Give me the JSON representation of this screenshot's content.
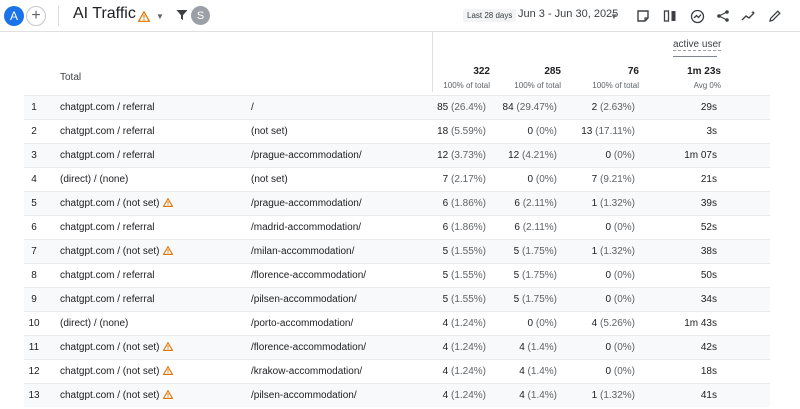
{
  "header": {
    "avatar_letter": "A",
    "add_symbol": "+",
    "title": "AI Traffic",
    "user_chip": "S",
    "date_label": "Last 28 days",
    "date_range": "Jun 3 - Jun 30, 2025",
    "icons": [
      "warning-icon",
      "chevron-down-icon",
      "filter-icon",
      "comment-icon",
      "compare-icon",
      "insights-icon",
      "share-icon",
      "trend-icon",
      "edit-icon"
    ]
  },
  "table": {
    "total_label": "Total",
    "col_hint": "active user",
    "totals": [
      {
        "value": "322",
        "sub": "100% of total"
      },
      {
        "value": "285",
        "sub": "100% of total"
      },
      {
        "value": "76",
        "sub": "100% of total"
      },
      {
        "value": "1m 23s",
        "sub": "Avg 0%"
      }
    ],
    "rows": [
      {
        "index": "1",
        "source": "chatgpt.com / referral",
        "warn": false,
        "page": "/",
        "c1": "85",
        "c1p": "(26.4%)",
        "c2": "84",
        "c2p": "(29.47%)",
        "c3": "2",
        "c3p": "(2.63%)",
        "c4": "29s"
      },
      {
        "index": "2",
        "source": "chatgpt.com / referral",
        "warn": false,
        "page": "(not set)",
        "c1": "18",
        "c1p": "(5.59%)",
        "c2": "0",
        "c2p": "(0%)",
        "c3": "13",
        "c3p": "(17.11%)",
        "c4": "3s"
      },
      {
        "index": "3",
        "source": "chatgpt.com / referral",
        "warn": false,
        "page": "/prague-accommodation/",
        "c1": "12",
        "c1p": "(3.73%)",
        "c2": "12",
        "c2p": "(4.21%)",
        "c3": "0",
        "c3p": "(0%)",
        "c4": "1m 07s"
      },
      {
        "index": "4",
        "source": "(direct) / (none)",
        "warn": false,
        "page": "(not set)",
        "c1": "7",
        "c1p": "(2.17%)",
        "c2": "0",
        "c2p": "(0%)",
        "c3": "7",
        "c3p": "(9.21%)",
        "c4": "21s"
      },
      {
        "index": "5",
        "source": "chatgpt.com / (not set)",
        "warn": true,
        "page": "/prague-accommodation/",
        "c1": "6",
        "c1p": "(1.86%)",
        "c2": "6",
        "c2p": "(2.11%)",
        "c3": "1",
        "c3p": "(1.32%)",
        "c4": "39s"
      },
      {
        "index": "6",
        "source": "chatgpt.com / referral",
        "warn": false,
        "page": "/madrid-accommodation/",
        "c1": "6",
        "c1p": "(1.86%)",
        "c2": "6",
        "c2p": "(2.11%)",
        "c3": "0",
        "c3p": "(0%)",
        "c4": "52s"
      },
      {
        "index": "7",
        "source": "chatgpt.com / (not set)",
        "warn": true,
        "page": "/milan-accommodation/",
        "c1": "5",
        "c1p": "(1.55%)",
        "c2": "5",
        "c2p": "(1.75%)",
        "c3": "1",
        "c3p": "(1.32%)",
        "c4": "38s"
      },
      {
        "index": "8",
        "source": "chatgpt.com / referral",
        "warn": false,
        "page": "/florence-accommodation/",
        "c1": "5",
        "c1p": "(1.55%)",
        "c2": "5",
        "c2p": "(1.75%)",
        "c3": "0",
        "c3p": "(0%)",
        "c4": "50s"
      },
      {
        "index": "9",
        "source": "chatgpt.com / referral",
        "warn": false,
        "page": "/pilsen-accommodation/",
        "c1": "5",
        "c1p": "(1.55%)",
        "c2": "5",
        "c2p": "(1.75%)",
        "c3": "0",
        "c3p": "(0%)",
        "c4": "34s"
      },
      {
        "index": "10",
        "source": "(direct) / (none)",
        "warn": false,
        "page": "/porto-accommodation/",
        "c1": "4",
        "c1p": "(1.24%)",
        "c2": "0",
        "c2p": "(0%)",
        "c3": "4",
        "c3p": "(5.26%)",
        "c4": "1m 43s"
      },
      {
        "index": "11",
        "source": "chatgpt.com / (not set)",
        "warn": true,
        "page": "/florence-accommodation/",
        "c1": "4",
        "c1p": "(1.24%)",
        "c2": "4",
        "c2p": "(1.4%)",
        "c3": "0",
        "c3p": "(0%)",
        "c4": "42s"
      },
      {
        "index": "12",
        "source": "chatgpt.com / (not set)",
        "warn": true,
        "page": "/krakow-accommodation/",
        "c1": "4",
        "c1p": "(1.24%)",
        "c2": "4",
        "c2p": "(1.4%)",
        "c3": "0",
        "c3p": "(0%)",
        "c4": "18s"
      },
      {
        "index": "13",
        "source": "chatgpt.com / (not set)",
        "warn": true,
        "page": "/pilsen-accommodation/",
        "c1": "4",
        "c1p": "(1.24%)",
        "c2": "4",
        "c2p": "(1.4%)",
        "c3": "1",
        "c3p": "(1.32%)",
        "c4": "41s"
      }
    ]
  },
  "colors": {
    "accent": "#1a73e8",
    "warning": "#e37400"
  }
}
